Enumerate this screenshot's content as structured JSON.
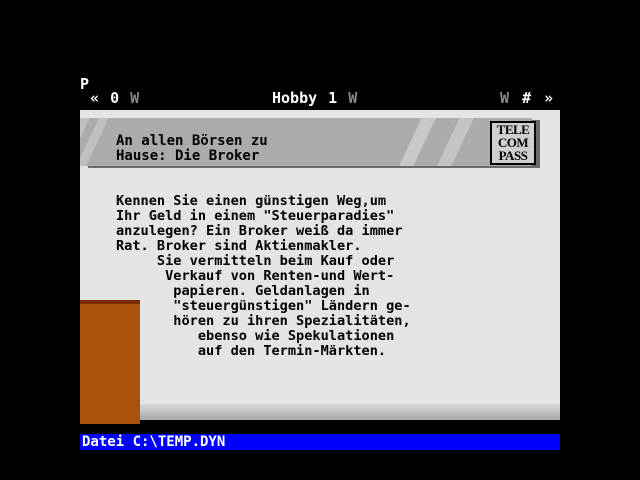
{
  "page_marker": "P",
  "nav": {
    "prev_arrows": "«",
    "left_num": "0",
    "left_w": "W",
    "title": "Hobby 1",
    "title_w": "W",
    "right_w": "W",
    "hash": "#",
    "next_arrows": "»"
  },
  "article": {
    "headline": "An allen Börsen zu\nHause: Die Broker",
    "logo_lines": [
      "TELE",
      "COM",
      "PASS"
    ],
    "body": "Kennen Sie einen günstigen Weg,um\nIhr Geld in einem \"Steuerparadies\"\nanzulegen? Ein Broker weiß da immer\nRat. Broker sind Aktienmakler.\n     Sie vermitteln beim Kauf oder\n      Verkauf von Renten-und Wert-\n       papieren. Geldanlagen in\n       \"steuergünstigen\" Ländern ge-\n       hören zu ihren Spezialitäten,\n          ebenso wie Spekulationen\n          auf den Termin-Märkten."
  },
  "status_bar": {
    "label": "Datei C:\\TEMP.DYN"
  },
  "colors": {
    "background": "#000000",
    "panel": "#e4e4e4",
    "status_bar": "#0000ff",
    "brown_block": "#a8520e"
  }
}
